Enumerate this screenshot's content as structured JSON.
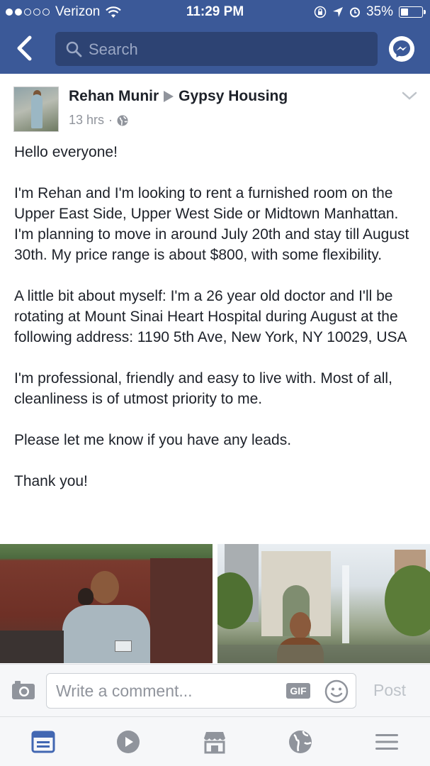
{
  "status_bar": {
    "carrier": "Verizon",
    "time": "11:29 PM",
    "battery_pct": "35%",
    "battery_level": 0.35,
    "signal_bars_filled": 2,
    "signal_bars_total": 5
  },
  "nav": {
    "back_icon": "chevron-left-icon",
    "search_placeholder": "Search",
    "messenger_icon": "messenger-icon"
  },
  "post": {
    "author": "Rehan Munir",
    "group": "Gypsy Housing",
    "time_ago": "13 hrs",
    "separator": "·",
    "privacy_icon": "globe-icon",
    "paragraphs": [
      "Hello everyone!",
      "I'm Rehan and I'm looking to rent a furnished room on the Upper East Side, Upper West Side or Midtown Manhattan. I'm planning to move in around July 20th and stay till August 30th. My price range is about $800, with some flexibility.",
      "A little bit about myself: I'm a 26 year old doctor and I'll be rotating at Mount Sinai Heart Hospital during August at the following address: 1190 5th Ave, New York, NY 10029, USA",
      "I'm professional, friendly and easy to live with. Most of all, cleanliness is of utmost priority to me.",
      "Please let me know if you have any leads.",
      "Thank you!"
    ]
  },
  "comment": {
    "placeholder": "Write a comment...",
    "gif_label": "GIF",
    "post_label": "Post"
  },
  "tabs": [
    {
      "icon": "news-feed-icon",
      "active": true
    },
    {
      "icon": "video-icon",
      "active": false
    },
    {
      "icon": "marketplace-icon",
      "active": false
    },
    {
      "icon": "globe-notifications-icon",
      "active": false
    },
    {
      "icon": "menu-icon",
      "active": false
    }
  ],
  "colors": {
    "brand": "#3b5998",
    "active_tab": "#4267b2",
    "inactive_tab": "#90949c"
  }
}
